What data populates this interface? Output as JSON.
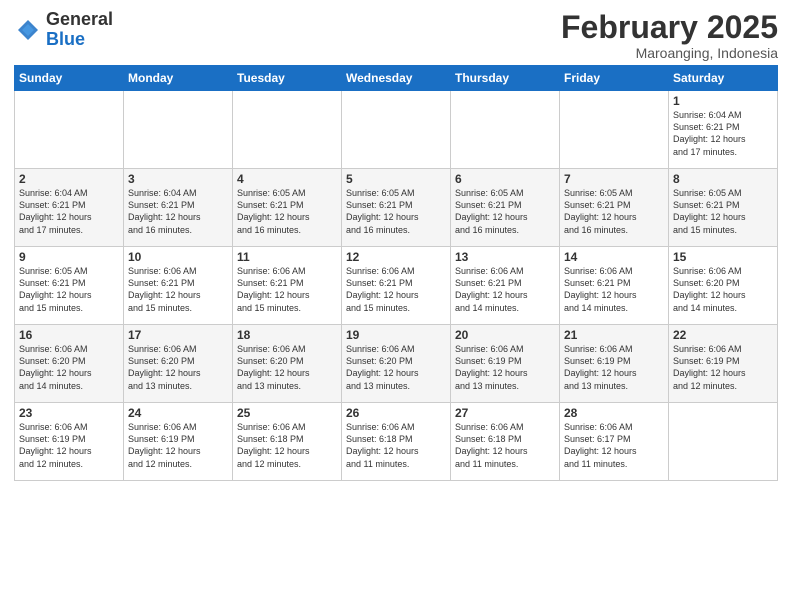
{
  "header": {
    "logo_general": "General",
    "logo_blue": "Blue",
    "month_title": "February 2025",
    "location": "Maroanging, Indonesia"
  },
  "weekdays": [
    "Sunday",
    "Monday",
    "Tuesday",
    "Wednesday",
    "Thursday",
    "Friday",
    "Saturday"
  ],
  "weeks": [
    [
      {
        "day": "",
        "info": ""
      },
      {
        "day": "",
        "info": ""
      },
      {
        "day": "",
        "info": ""
      },
      {
        "day": "",
        "info": ""
      },
      {
        "day": "",
        "info": ""
      },
      {
        "day": "",
        "info": ""
      },
      {
        "day": "1",
        "info": "Sunrise: 6:04 AM\nSunset: 6:21 PM\nDaylight: 12 hours\nand 17 minutes."
      }
    ],
    [
      {
        "day": "2",
        "info": "Sunrise: 6:04 AM\nSunset: 6:21 PM\nDaylight: 12 hours\nand 17 minutes."
      },
      {
        "day": "3",
        "info": "Sunrise: 6:04 AM\nSunset: 6:21 PM\nDaylight: 12 hours\nand 16 minutes."
      },
      {
        "day": "4",
        "info": "Sunrise: 6:05 AM\nSunset: 6:21 PM\nDaylight: 12 hours\nand 16 minutes."
      },
      {
        "day": "5",
        "info": "Sunrise: 6:05 AM\nSunset: 6:21 PM\nDaylight: 12 hours\nand 16 minutes."
      },
      {
        "day": "6",
        "info": "Sunrise: 6:05 AM\nSunset: 6:21 PM\nDaylight: 12 hours\nand 16 minutes."
      },
      {
        "day": "7",
        "info": "Sunrise: 6:05 AM\nSunset: 6:21 PM\nDaylight: 12 hours\nand 16 minutes."
      },
      {
        "day": "8",
        "info": "Sunrise: 6:05 AM\nSunset: 6:21 PM\nDaylight: 12 hours\nand 15 minutes."
      }
    ],
    [
      {
        "day": "9",
        "info": "Sunrise: 6:05 AM\nSunset: 6:21 PM\nDaylight: 12 hours\nand 15 minutes."
      },
      {
        "day": "10",
        "info": "Sunrise: 6:06 AM\nSunset: 6:21 PM\nDaylight: 12 hours\nand 15 minutes."
      },
      {
        "day": "11",
        "info": "Sunrise: 6:06 AM\nSunset: 6:21 PM\nDaylight: 12 hours\nand 15 minutes."
      },
      {
        "day": "12",
        "info": "Sunrise: 6:06 AM\nSunset: 6:21 PM\nDaylight: 12 hours\nand 15 minutes."
      },
      {
        "day": "13",
        "info": "Sunrise: 6:06 AM\nSunset: 6:21 PM\nDaylight: 12 hours\nand 14 minutes."
      },
      {
        "day": "14",
        "info": "Sunrise: 6:06 AM\nSunset: 6:21 PM\nDaylight: 12 hours\nand 14 minutes."
      },
      {
        "day": "15",
        "info": "Sunrise: 6:06 AM\nSunset: 6:20 PM\nDaylight: 12 hours\nand 14 minutes."
      }
    ],
    [
      {
        "day": "16",
        "info": "Sunrise: 6:06 AM\nSunset: 6:20 PM\nDaylight: 12 hours\nand 14 minutes."
      },
      {
        "day": "17",
        "info": "Sunrise: 6:06 AM\nSunset: 6:20 PM\nDaylight: 12 hours\nand 13 minutes."
      },
      {
        "day": "18",
        "info": "Sunrise: 6:06 AM\nSunset: 6:20 PM\nDaylight: 12 hours\nand 13 minutes."
      },
      {
        "day": "19",
        "info": "Sunrise: 6:06 AM\nSunset: 6:20 PM\nDaylight: 12 hours\nand 13 minutes."
      },
      {
        "day": "20",
        "info": "Sunrise: 6:06 AM\nSunset: 6:19 PM\nDaylight: 12 hours\nand 13 minutes."
      },
      {
        "day": "21",
        "info": "Sunrise: 6:06 AM\nSunset: 6:19 PM\nDaylight: 12 hours\nand 13 minutes."
      },
      {
        "day": "22",
        "info": "Sunrise: 6:06 AM\nSunset: 6:19 PM\nDaylight: 12 hours\nand 12 minutes."
      }
    ],
    [
      {
        "day": "23",
        "info": "Sunrise: 6:06 AM\nSunset: 6:19 PM\nDaylight: 12 hours\nand 12 minutes."
      },
      {
        "day": "24",
        "info": "Sunrise: 6:06 AM\nSunset: 6:19 PM\nDaylight: 12 hours\nand 12 minutes."
      },
      {
        "day": "25",
        "info": "Sunrise: 6:06 AM\nSunset: 6:18 PM\nDaylight: 12 hours\nand 12 minutes."
      },
      {
        "day": "26",
        "info": "Sunrise: 6:06 AM\nSunset: 6:18 PM\nDaylight: 12 hours\nand 11 minutes."
      },
      {
        "day": "27",
        "info": "Sunrise: 6:06 AM\nSunset: 6:18 PM\nDaylight: 12 hours\nand 11 minutes."
      },
      {
        "day": "28",
        "info": "Sunrise: 6:06 AM\nSunset: 6:17 PM\nDaylight: 12 hours\nand 11 minutes."
      },
      {
        "day": "",
        "info": ""
      }
    ]
  ]
}
